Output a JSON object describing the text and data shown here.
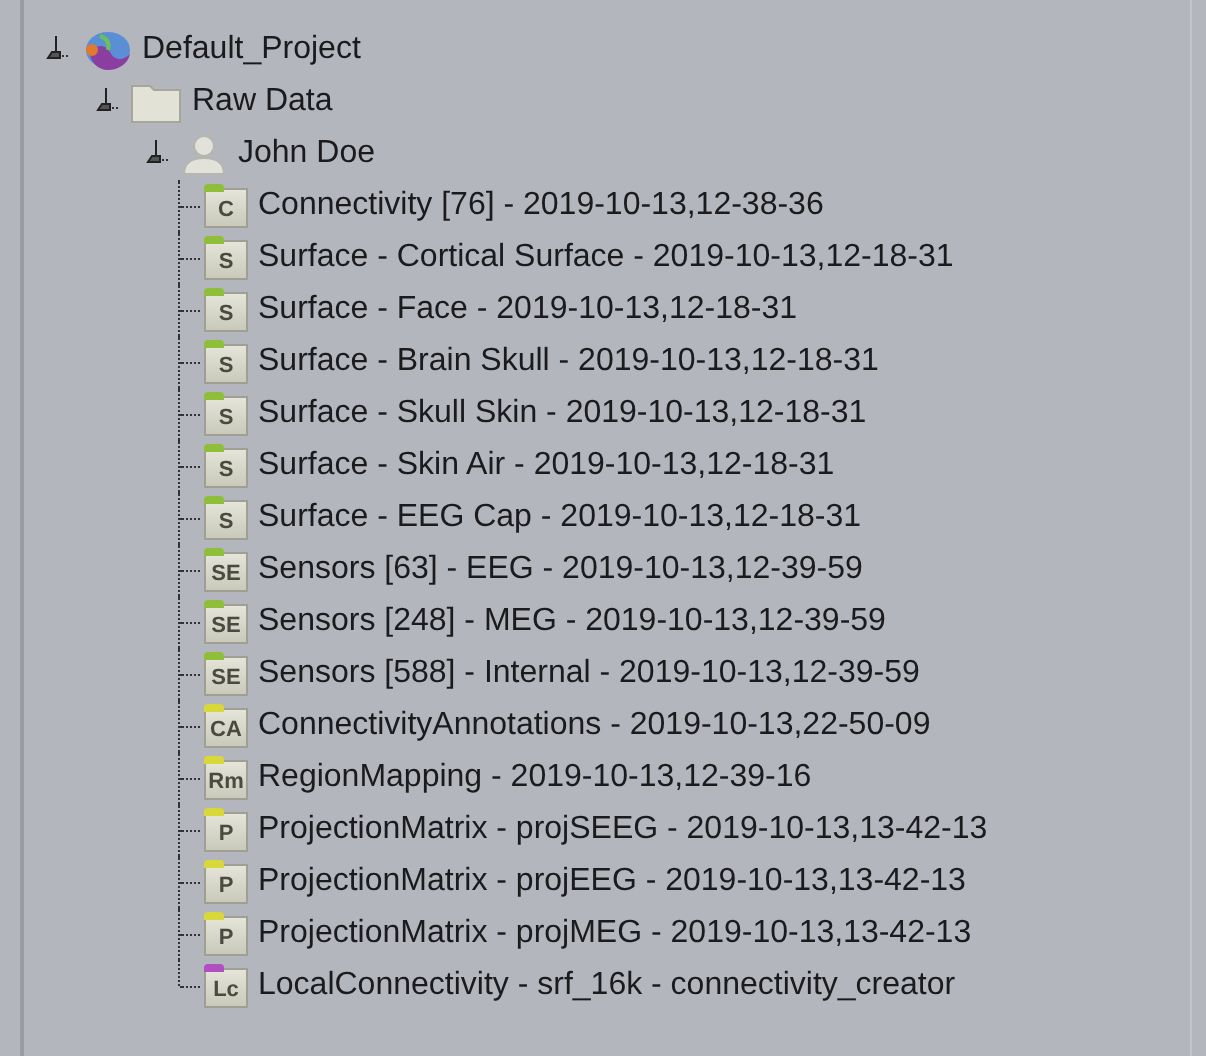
{
  "tree": [
    {
      "label": "Default_Project",
      "kind": "project",
      "expanded": true,
      "children": [
        {
          "label": "Raw Data",
          "kind": "folder",
          "expanded": true,
          "children": [
            {
              "label": "John Doe",
              "kind": "subject",
              "expanded": true,
              "children": [
                {
                  "label": "Connectivity [76] - 2019-10-13,12-38-36",
                  "kind": "data",
                  "badge": "C",
                  "color": "#8fbf3a"
                },
                {
                  "label": "Surface - Cortical Surface - 2019-10-13,12-18-31",
                  "kind": "data",
                  "badge": "S",
                  "color": "#8fbf3a"
                },
                {
                  "label": "Surface - Face - 2019-10-13,12-18-31",
                  "kind": "data",
                  "badge": "S",
                  "color": "#8fbf3a"
                },
                {
                  "label": "Surface - Brain Skull - 2019-10-13,12-18-31",
                  "kind": "data",
                  "badge": "S",
                  "color": "#8fbf3a"
                },
                {
                  "label": "Surface - Skull Skin - 2019-10-13,12-18-31",
                  "kind": "data",
                  "badge": "S",
                  "color": "#8fbf3a"
                },
                {
                  "label": "Surface - Skin Air - 2019-10-13,12-18-31",
                  "kind": "data",
                  "badge": "S",
                  "color": "#8fbf3a"
                },
                {
                  "label": "Surface - EEG Cap - 2019-10-13,12-18-31",
                  "kind": "data",
                  "badge": "S",
                  "color": "#8fbf3a"
                },
                {
                  "label": "Sensors [63] - EEG - 2019-10-13,12-39-59",
                  "kind": "data",
                  "badge": "SE",
                  "color": "#8fbf3a"
                },
                {
                  "label": "Sensors [248] - MEG - 2019-10-13,12-39-59",
                  "kind": "data",
                  "badge": "SE",
                  "color": "#8fbf3a"
                },
                {
                  "label": "Sensors [588] - Internal - 2019-10-13,12-39-59",
                  "kind": "data",
                  "badge": "SE",
                  "color": "#8fbf3a"
                },
                {
                  "label": "ConnectivityAnnotations - 2019-10-13,22-50-09",
                  "kind": "data",
                  "badge": "CA",
                  "color": "#d9d83a"
                },
                {
                  "label": "RegionMapping - 2019-10-13,12-39-16",
                  "kind": "data",
                  "badge": "Rm",
                  "color": "#d9d83a"
                },
                {
                  "label": "ProjectionMatrix - projSEEG - 2019-10-13,13-42-13",
                  "kind": "data",
                  "badge": "P",
                  "color": "#d9d83a"
                },
                {
                  "label": "ProjectionMatrix - projEEG - 2019-10-13,13-42-13",
                  "kind": "data",
                  "badge": "P",
                  "color": "#d9d83a"
                },
                {
                  "label": "ProjectionMatrix - projMEG - 2019-10-13,13-42-13",
                  "kind": "data",
                  "badge": "P",
                  "color": "#d9d83a"
                },
                {
                  "label": "LocalConnectivity - srf_16k - connectivity_creator",
                  "kind": "data",
                  "badge": "Lc",
                  "color": "#b24fc0"
                }
              ]
            }
          ]
        }
      ]
    }
  ]
}
